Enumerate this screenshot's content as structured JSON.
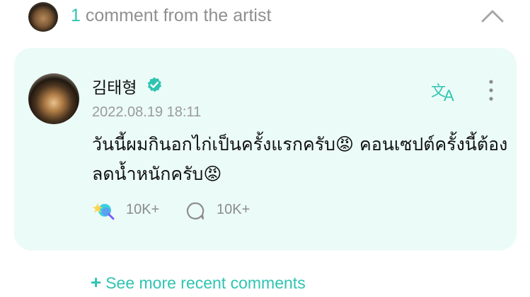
{
  "header": {
    "count": "1",
    "label": " comment from the artist"
  },
  "comment": {
    "author": "김태형",
    "timestamp": "2022.08.19 18:11",
    "text": "วันนี้ผมกินอกไก่เป็นครั้งแรกครับ😡 คอนเซปต์ครั้งนี้ต้องลดน้ำหนักครับ😡",
    "likes": "10K+",
    "replies": "10K+"
  },
  "footer": {
    "see_more_icon": "+",
    "see_more_label": "See more recent comments"
  },
  "colors": {
    "accent": "#2fc4b2",
    "card_bg": "#ebfbf7",
    "muted": "#8f8f8f"
  },
  "icons": [
    "collapse-chevron-icon",
    "verified-icon",
    "translate-icon",
    "more-icon",
    "like-icon",
    "reply-icon"
  ]
}
